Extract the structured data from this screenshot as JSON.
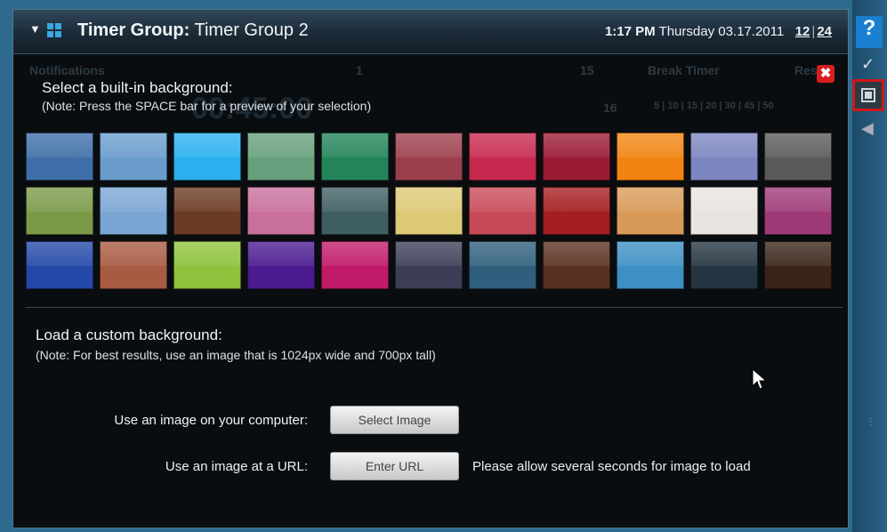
{
  "titlebar": {
    "label_bold": "Timer Group:",
    "label_value": "Timer Group 2",
    "time": "1:17 PM",
    "day_date": "Thursday 03.17.2011",
    "format_12": "12",
    "format_24": "24"
  },
  "ghost": {
    "notification": "Notifications",
    "break_timer": "Break Timer",
    "reset": "Reset",
    "num1": "1",
    "num15": "15",
    "num16": "16",
    "big": "00:45:00",
    "scale": "5 | 10 | 15 | 20 | 30 | 45 | 50"
  },
  "builtin": {
    "heading": "Select a built-in background:",
    "note": "(Note: Press the SPACE bar for a preview of your selection)"
  },
  "swatches": [
    {
      "name": "swatch-blue",
      "color": "#3f6fa8"
    },
    {
      "name": "swatch-light-blue",
      "color": "#6a9ccc"
    },
    {
      "name": "swatch-cyan",
      "color": "#2ab0ee"
    },
    {
      "name": "swatch-sage",
      "color": "#67a07c"
    },
    {
      "name": "swatch-green",
      "color": "#23845a"
    },
    {
      "name": "swatch-rose",
      "color": "#9c3f4c"
    },
    {
      "name": "swatch-crimson",
      "color": "#c7284e"
    },
    {
      "name": "swatch-maroon",
      "color": "#9a1a34"
    },
    {
      "name": "swatch-orange",
      "color": "#f18410"
    },
    {
      "name": "swatch-lavender",
      "color": "#7c86c0"
    },
    {
      "name": "swatch-gray",
      "color": "#5a5a5a"
    },
    {
      "name": "swatch-olive",
      "color": "#7b9a48"
    },
    {
      "name": "swatch-blue-texture",
      "color": "#7aa6d4"
    },
    {
      "name": "swatch-brown",
      "color": "#6a3a22"
    },
    {
      "name": "swatch-pink",
      "color": "#c86f9c"
    },
    {
      "name": "swatch-teal-gray",
      "color": "#3f5e62"
    },
    {
      "name": "swatch-yellow",
      "color": "#ddc876"
    },
    {
      "name": "swatch-coral",
      "color": "#c84a58"
    },
    {
      "name": "swatch-red-floral",
      "color": "#a41d20"
    },
    {
      "name": "swatch-tan-texture",
      "color": "#d89a58"
    },
    {
      "name": "swatch-white-pattern",
      "color": "#e8e4e0"
    },
    {
      "name": "swatch-magenta",
      "color": "#9e3a78"
    },
    {
      "name": "swatch-stripes",
      "color": "#2448a8"
    },
    {
      "name": "swatch-brick",
      "color": "#a85a42"
    },
    {
      "name": "swatch-lime-texture",
      "color": "#8ec23c"
    },
    {
      "name": "swatch-purple",
      "color": "#4a1a8e"
    },
    {
      "name": "swatch-hot-pink",
      "color": "#c01a68"
    },
    {
      "name": "swatch-slate",
      "color": "#3c3e58"
    },
    {
      "name": "swatch-steel-blue",
      "color": "#2f5f7c"
    },
    {
      "name": "swatch-wood",
      "color": "#5a3020"
    },
    {
      "name": "swatch-sky-blue",
      "color": "#3d8fc4"
    },
    {
      "name": "swatch-dark-texture",
      "color": "#243440"
    },
    {
      "name": "swatch-dark-wood",
      "color": "#3a2418"
    }
  ],
  "custom": {
    "heading": "Load a custom background:",
    "note": "(Note: For best results, use an image that is 1024px wide and 700px tall)",
    "computer_label": "Use an image on your computer:",
    "select_button": "Select Image",
    "url_label": "Use an image at a URL:",
    "url_button": "Enter URL",
    "hint": "Please allow several seconds for image to load"
  },
  "rail": {
    "help": "?",
    "check": "✓",
    "speaker": "◀",
    "dots": "⋮"
  },
  "close_glyph": "✖"
}
